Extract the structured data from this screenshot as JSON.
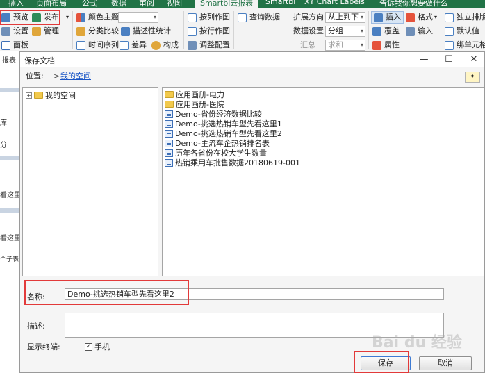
{
  "ribbon": {
    "tabs": [
      "插入",
      "页面布局",
      "公式",
      "数据",
      "审阅",
      "视图",
      "Smartbi云报表",
      "Smartbi",
      "XY Chart Labels",
      "告诉我你想要做什么"
    ],
    "preview": "预览",
    "publish": "发布",
    "settings": "设置",
    "manage": "管理",
    "panel": "面板",
    "color_theme": "颜色主题",
    "category_compare": "分类比较",
    "descriptive_stats": "描述性统计",
    "time_series": "时间序列",
    "difference": "差异",
    "composition": "构成",
    "col_chart": "按列作图",
    "row_chart": "按行作图",
    "adjust_config": "调整配置",
    "query_data": "查询数据",
    "expand_direction_label": "扩展方向",
    "expand_direction_value": "从上到下",
    "data_settings_label": "数据设置",
    "data_settings_value": "分组",
    "summary_label": "汇总",
    "summary_value": "求和",
    "insert": "插入",
    "format": "格式",
    "cover": "覆盖",
    "input": "输入",
    "properties": "属性",
    "standalone": "独立排版",
    "default_value": "默认值",
    "bind_cell": "绑单元格"
  },
  "left_pane": {
    "tab_label": "报表",
    "items": [
      "库",
      "分",
      "看这里",
      "看这里",
      "个子表格"
    ]
  },
  "dialog": {
    "title": "保存文档",
    "location_label": "位置:",
    "location_arrow": ">",
    "location_path": "我的空间",
    "tree_root": "我的空间",
    "files": [
      {
        "name": "应用画册-电力",
        "type": "folder"
      },
      {
        "name": "应用画册-医院",
        "type": "folder"
      },
      {
        "name": "Demo-省份经济数据比较",
        "type": "report"
      },
      {
        "name": "Demo-挑选热销车型先看这里1",
        "type": "report"
      },
      {
        "name": "Demo-挑选热销车型先看这里2",
        "type": "report"
      },
      {
        "name": "Demo-主流车企热销排名表",
        "type": "report"
      },
      {
        "name": "历年各省份在校大学生数量",
        "type": "report"
      },
      {
        "name": "热销乘用车批售数据20180619-001",
        "type": "report"
      }
    ],
    "name_label": "名称:",
    "name_value": "Demo-挑选热销车型先看这里2",
    "desc_label": "描述:",
    "desc_value": "",
    "terminal_label": "显示终端:",
    "terminal_option": "手机",
    "terminal_checked": true,
    "save_label": "保存",
    "cancel_label": "取消"
  },
  "watermark": "Bai du 经验",
  "colors": {
    "ribbon_green": "#217346",
    "highlight_red": "#e23a3a",
    "link_blue": "#1a56c6",
    "folder_yellow": "#f2c94c"
  }
}
